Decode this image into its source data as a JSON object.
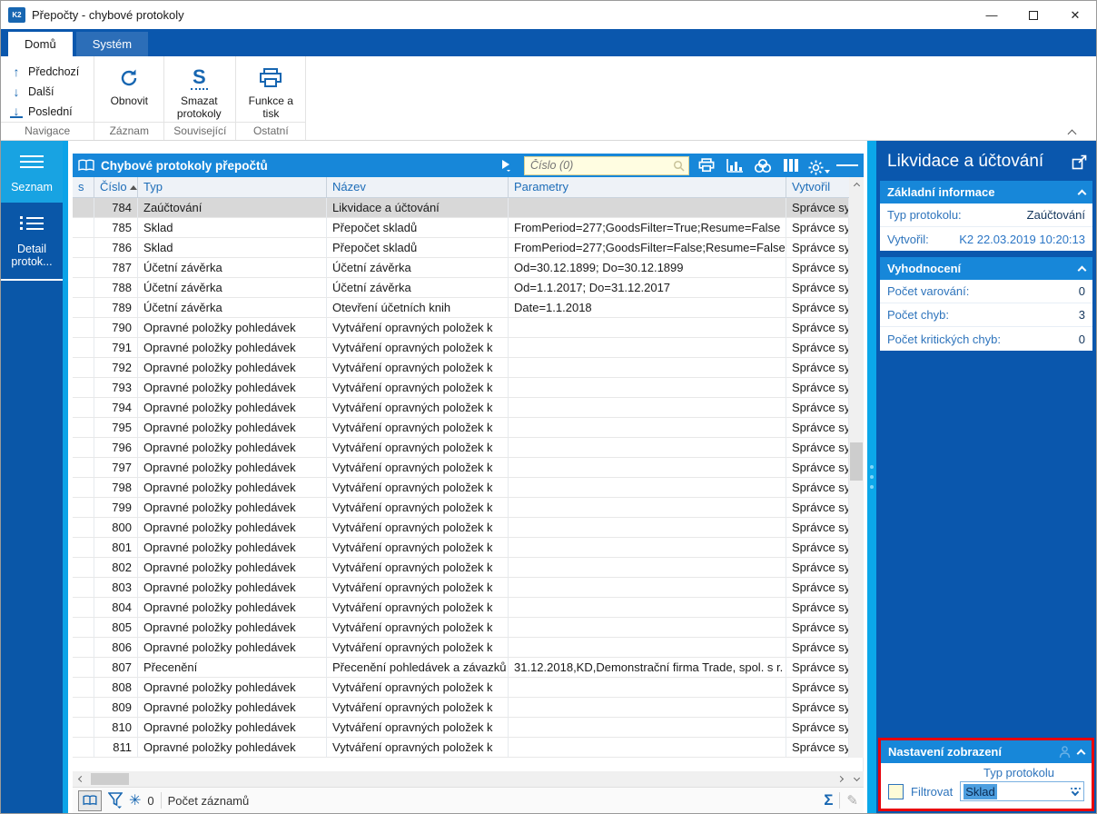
{
  "window": {
    "title": "Přepočty - chybové protokoly"
  },
  "ribbon": {
    "tabs": [
      {
        "label": "Domů"
      },
      {
        "label": "Systém"
      }
    ],
    "nav": [
      {
        "label": "Předchozí"
      },
      {
        "label": "Další"
      },
      {
        "label": "Poslední"
      }
    ],
    "buttons": [
      {
        "label": "Obnovit"
      },
      {
        "label": "Smazat protokoly"
      },
      {
        "label": "Funkce a tisk"
      }
    ],
    "groups": [
      {
        "label": "Navigace"
      },
      {
        "label": "Záznam"
      },
      {
        "label": "Související"
      },
      {
        "label": "Ostatní"
      }
    ]
  },
  "sidebar": {
    "items": [
      {
        "label": "Seznam"
      },
      {
        "label": "Detail protok..."
      }
    ]
  },
  "table": {
    "title": "Chybové protokoly přepočtů",
    "search_placeholder": "Číslo (0)",
    "columns": [
      "s",
      "Číslo",
      "Typ",
      "Název",
      "Parametry",
      "Vytvořil"
    ],
    "selected_cislo": "784",
    "rows": [
      [
        "784",
        "Zaúčtování",
        "Likvidace a účtování",
        "",
        "Správce sy"
      ],
      [
        "785",
        "Sklad",
        "Přepočet skladů",
        "FromPeriod=277;GoodsFilter=True;Resume=False",
        "Správce sy"
      ],
      [
        "786",
        "Sklad",
        "Přepočet skladů",
        "FromPeriod=277;GoodsFilter=False;Resume=False",
        "Správce sy"
      ],
      [
        "787",
        "Účetní závěrka",
        "Účetní závěrka",
        "Od=30.12.1899; Do=30.12.1899",
        "Správce sy"
      ],
      [
        "788",
        "Účetní závěrka",
        "Účetní závěrka",
        "Od=1.1.2017; Do=31.12.2017",
        "Správce sy"
      ],
      [
        "789",
        "Účetní závěrka",
        "Otevření účetních knih",
        "Date=1.1.2018",
        "Správce sy"
      ],
      [
        "790",
        "Opravné položky pohledávek",
        "Vytváření opravných položek k",
        "",
        "Správce sy"
      ],
      [
        "791",
        "Opravné položky pohledávek",
        "Vytváření opravných položek k",
        "",
        "Správce sy"
      ],
      [
        "792",
        "Opravné položky pohledávek",
        "Vytváření opravných položek k",
        "",
        "Správce sy"
      ],
      [
        "793",
        "Opravné položky pohledávek",
        "Vytváření opravných položek k",
        "",
        "Správce sy"
      ],
      [
        "794",
        "Opravné položky pohledávek",
        "Vytváření opravných položek k",
        "",
        "Správce sy"
      ],
      [
        "795",
        "Opravné položky pohledávek",
        "Vytváření opravných položek k",
        "",
        "Správce sy"
      ],
      [
        "796",
        "Opravné položky pohledávek",
        "Vytváření opravných položek k",
        "",
        "Správce sy"
      ],
      [
        "797",
        "Opravné položky pohledávek",
        "Vytváření opravných položek k",
        "",
        "Správce sy"
      ],
      [
        "798",
        "Opravné položky pohledávek",
        "Vytváření opravných položek k",
        "",
        "Správce sy"
      ],
      [
        "799",
        "Opravné položky pohledávek",
        "Vytváření opravných položek k",
        "",
        "Správce sy"
      ],
      [
        "800",
        "Opravné položky pohledávek",
        "Vytváření opravných položek k",
        "",
        "Správce sy"
      ],
      [
        "801",
        "Opravné položky pohledávek",
        "Vytváření opravných položek k",
        "",
        "Správce sy"
      ],
      [
        "802",
        "Opravné položky pohledávek",
        "Vytváření opravných položek k",
        "",
        "Správce sy"
      ],
      [
        "803",
        "Opravné položky pohledávek",
        "Vytváření opravných položek k",
        "",
        "Správce sy"
      ],
      [
        "804",
        "Opravné položky pohledávek",
        "Vytváření opravných položek k",
        "",
        "Správce sy"
      ],
      [
        "805",
        "Opravné položky pohledávek",
        "Vytváření opravných položek k",
        "",
        "Správce sy"
      ],
      [
        "806",
        "Opravné položky pohledávek",
        "Vytváření opravných položek k",
        "",
        "Správce sy"
      ],
      [
        "807",
        "Přecenění",
        "Přecenění pohledávek a závazků",
        "31.12.2018,KD,Demonstrační firma Trade, spol. s r.",
        "Správce sy"
      ],
      [
        "808",
        "Opravné položky pohledávek",
        "Vytváření opravných položek k",
        "",
        "Správce sy"
      ],
      [
        "809",
        "Opravné položky pohledávek",
        "Vytváření opravných položek k",
        "",
        "Správce sy"
      ],
      [
        "810",
        "Opravné položky pohledávek",
        "Vytváření opravných položek k",
        "",
        "Správce sy"
      ],
      [
        "811",
        "Opravné položky pohledávek",
        "Vytváření opravných položek k",
        "",
        "Správce sy"
      ]
    ],
    "status": {
      "flake_count": "0",
      "records_label": "Počet záznamů",
      "sigma_glyph": "Σ",
      "pencil_glyph": "✎",
      "flake_glyph": "✳"
    }
  },
  "panel": {
    "title": "Likvidace a účtování",
    "basic": {
      "header": "Základní informace",
      "rows": [
        {
          "label": "Typ protokolu:",
          "value": "Zaúčtování"
        },
        {
          "label": "Vytvořil:",
          "value": "K2 22.03.2019 10:20:13"
        }
      ]
    },
    "eval": {
      "header": "Vyhodnocení",
      "rows": [
        {
          "label": "Počet varování:",
          "value": "0"
        },
        {
          "label": "Počet chyb:",
          "value": "3"
        },
        {
          "label": "Počet kritických chyb:",
          "value": "0"
        }
      ]
    },
    "settings": {
      "header": "Nastavení zobrazení",
      "field_label": "Typ protokolu",
      "checkbox_label": "Filtrovat",
      "combo_value": "Sklad",
      "highlight_color": "#e8000a"
    }
  },
  "colors": {
    "dark_blue": "#0a57ad",
    "mid_blue": "#1787d9",
    "light_blue": "#0ba7ea",
    "search_yellow": "#fffde1"
  }
}
